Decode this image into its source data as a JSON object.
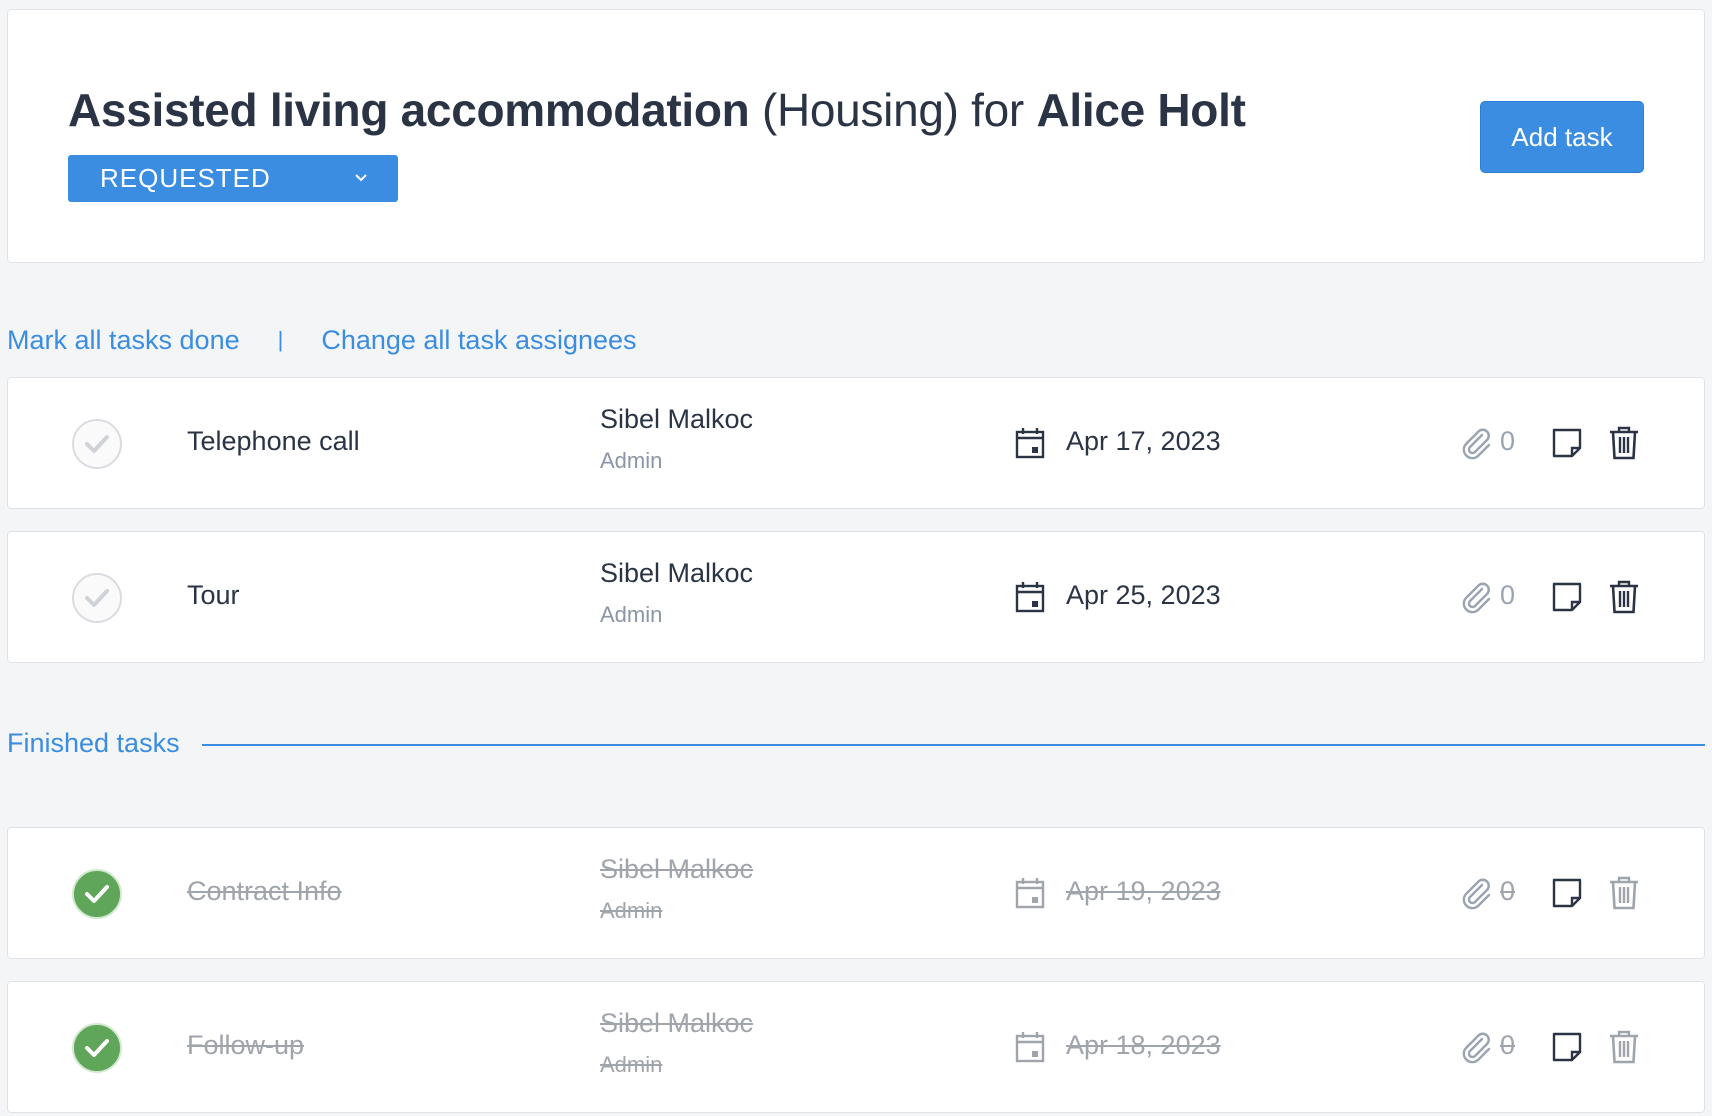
{
  "header": {
    "task_type": "Assisted living accommodation",
    "category": "(Housing)",
    "for_word": "for",
    "client_name": "Alice Holt",
    "status": "REQUESTED",
    "add_task_label": "Add task"
  },
  "bulk_actions": {
    "mark_all_done": "Mark all tasks done",
    "separator": "|",
    "change_assignees": "Change all task assignees"
  },
  "open_tasks": [
    {
      "name": "Telephone call",
      "assignee": "Sibel Malkoc",
      "role": "Admin",
      "due": "Apr 17, 2023",
      "attachments": "0"
    },
    {
      "name": "Tour",
      "assignee": "Sibel Malkoc",
      "role": "Admin",
      "due": "Apr 25, 2023",
      "attachments": "0"
    }
  ],
  "finished_section": {
    "label": "Finished tasks"
  },
  "finished_tasks": [
    {
      "name": "Contract Info",
      "assignee": "Sibel Malkoc",
      "role": "Admin",
      "due": "Apr 19, 2023",
      "attachments": "0"
    },
    {
      "name": "Follow-up",
      "assignee": "Sibel Malkoc",
      "role": "Admin",
      "due": "Apr 18, 2023",
      "attachments": "0"
    }
  ],
  "colors": {
    "accent": "#3a8de0",
    "done_green": "#5fa55a",
    "text_dark": "#2b3445",
    "text_muted": "#8b95a5",
    "struck_gray": "#a0a4ab"
  },
  "icons": [
    "chevron-down-icon",
    "checkmark-icon",
    "calendar-icon",
    "paperclip-icon",
    "note-icon",
    "trash-icon"
  ]
}
